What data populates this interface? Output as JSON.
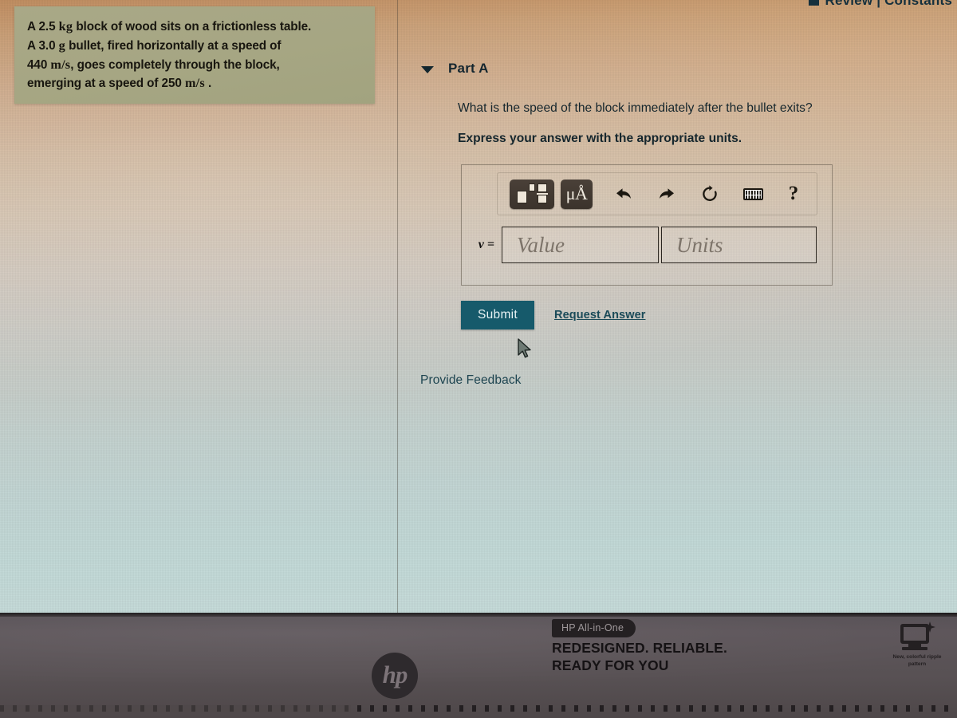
{
  "header": {
    "review_label": "Review | Constants",
    "review_icon": "square-icon"
  },
  "problem": {
    "line1_a": "A 2.5",
    "line1_unit": "kg",
    "line1_b": "block of wood sits on a frictionless table.",
    "line2_a": "A 3.0",
    "line2_unit": "g",
    "line2_b": "bullet, fired horizontally at a speed of",
    "line3_value": "440",
    "line3_unit": "m/s",
    "line3_b": ", goes completely through the block,",
    "line4_a": "emerging at a speed of 250",
    "line4_unit": "m/s",
    "line4_b": ".",
    "background_color": "#a6a683"
  },
  "part": {
    "caret_icon": "caret-down-icon",
    "title": "Part A",
    "question": "What is the speed of the block immediately after the bullet exits?",
    "instruction": "Express your answer with the appropriate units."
  },
  "answer": {
    "variable_label": "v =",
    "value_placeholder": "Value",
    "units_placeholder": "Units",
    "value_current": "",
    "units_current": "",
    "toolbar": [
      {
        "name": "template-picker-icon",
        "label": "",
        "style": "dark"
      },
      {
        "name": "units-micro-angstrom-icon",
        "label": "μÅ",
        "style": "dark"
      },
      {
        "name": "undo-icon",
        "label": "⬏",
        "style": "plain"
      },
      {
        "name": "redo-icon",
        "label": "⬎",
        "style": "plain"
      },
      {
        "name": "reset-icon",
        "label": "↻",
        "style": "plain"
      },
      {
        "name": "keyboard-icon",
        "label": "",
        "style": "plain"
      },
      {
        "name": "help-icon",
        "label": "?",
        "style": "plain"
      }
    ]
  },
  "actions": {
    "submit_label": "Submit",
    "request_answer_label": "Request Answer",
    "provide_feedback_label": "Provide Feedback",
    "submit_color": "#165a6b",
    "link_color": "#1a4a58"
  },
  "bezel": {
    "hp_logo_text": "hp",
    "ad_pill": "HP All-in-One",
    "ad_line1": "REDESIGNED. RELIABLE.",
    "ad_line2": "READY FOR YOU",
    "badge_icon": "monitor-sparkle-icon",
    "badge_caption": "New, colorful ripple pattern"
  }
}
